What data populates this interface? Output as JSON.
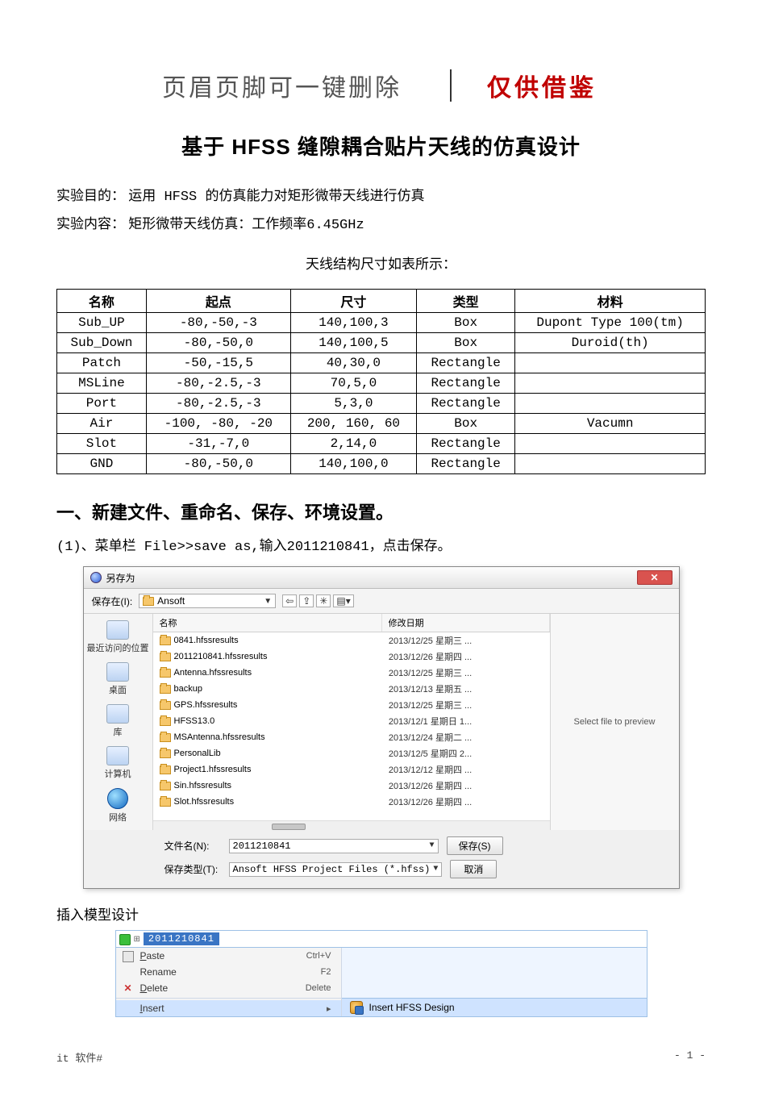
{
  "header": {
    "left": "页眉页脚可一键删除",
    "right": "仅供借鉴"
  },
  "title": "基于 HFSS 缝隙耦合贴片天线的仿真设计",
  "intro": {
    "purpose_label": "实验目的：",
    "purpose": "运用 HFSS 的仿真能力对矩形微带天线进行仿真",
    "content_label": "实验内容：",
    "content": "矩形微带天线仿真：工作频率6.45GHz"
  },
  "table_caption": "天线结构尺寸如表所示：",
  "table_headers": [
    "名称",
    "起点",
    "尺寸",
    "类型",
    "材料"
  ],
  "table_rows": [
    {
      "name": "Sub_UP",
      "start": "-80,-50,-3",
      "size": "140,100,3",
      "type": "Box",
      "material": "Dupont Type 100(tm)"
    },
    {
      "name": "Sub_Down",
      "start": "-80,-50,0",
      "size": "140,100,5",
      "type": "Box",
      "material": "Duroid(th)"
    },
    {
      "name": "Patch",
      "start": "-50,-15,5",
      "size": "40,30,0",
      "type": "Rectangle",
      "material": ""
    },
    {
      "name": "MSLine",
      "start": "-80,-2.5,-3",
      "size": "70,5,0",
      "type": "Rectangle",
      "material": ""
    },
    {
      "name": "Port",
      "start": "-80,-2.5,-3",
      "size": "5,3,0",
      "type": "Rectangle",
      "material": ""
    },
    {
      "name": "Air",
      "start": "-100, -80, -20",
      "size": "200, 160, 60",
      "type": "Box",
      "material": "Vacumn"
    },
    {
      "name": "Slot",
      "start": "-31,-7,0",
      "size": "2,14,0",
      "type": "Rectangle",
      "material": ""
    },
    {
      "name": "GND",
      "start": "-80,-50,0",
      "size": "140,100,0",
      "type": "Rectangle",
      "material": ""
    }
  ],
  "section1": "一、新建文件、重命名、保存、环境设置。",
  "step1": "(1)、菜单栏 File>>save as,输入2011210841，点击保存。",
  "dialog": {
    "title": "另存为",
    "save_in_label": "保存在(I):",
    "save_in_value": "Ansoft",
    "columns": {
      "name": "名称",
      "date": "修改日期"
    },
    "files": [
      {
        "name": "0841.hfssresults",
        "date": "2013/12/25 星期三 ..."
      },
      {
        "name": "2011210841.hfssresults",
        "date": "2013/12/26 星期四 ..."
      },
      {
        "name": "Antenna.hfssresults",
        "date": "2013/12/25 星期三 ..."
      },
      {
        "name": "backup",
        "date": "2013/12/13 星期五 ..."
      },
      {
        "name": "GPS.hfssresults",
        "date": "2013/12/25 星期三 ..."
      },
      {
        "name": "HFSS13.0",
        "date": "2013/12/1 星期日 1..."
      },
      {
        "name": "MSAntenna.hfssresults",
        "date": "2013/12/24 星期二 ..."
      },
      {
        "name": "PersonalLib",
        "date": "2013/12/5 星期四 2..."
      },
      {
        "name": "Project1.hfssresults",
        "date": "2013/12/12 星期四 ..."
      },
      {
        "name": "Sin.hfssresults",
        "date": "2013/12/26 星期四 ..."
      },
      {
        "name": "Slot.hfssresults",
        "date": "2013/12/26 星期四 ..."
      }
    ],
    "places": [
      "最近访问的位置",
      "桌面",
      "库",
      "计算机",
      "网络"
    ],
    "preview": "Select file to preview",
    "filename_label": "文件名(N):",
    "filename_value": "2011210841",
    "filetype_label": "保存类型(T):",
    "filetype_value": "Ansoft HFSS Project Files (*.hfss)",
    "save_btn": "保存(S)",
    "cancel_btn": "取消"
  },
  "caption2": "插入模型设计",
  "context_menu": {
    "selected_node": "2011210841",
    "items": [
      {
        "label": "Paste",
        "u": "P",
        "shortcut": "Ctrl+V",
        "icon": "paste"
      },
      {
        "label": "Rename",
        "u": "",
        "shortcut": "F2",
        "icon": ""
      },
      {
        "label": "Delete",
        "u": "D",
        "shortcut": "Delete",
        "icon": "del"
      }
    ],
    "highlight": {
      "label": "Insert",
      "u": "I",
      "shortcut": ""
    },
    "submenu": "Insert HFSS Design"
  },
  "footer": {
    "left": "it 软件#",
    "right": "- 1 -"
  }
}
